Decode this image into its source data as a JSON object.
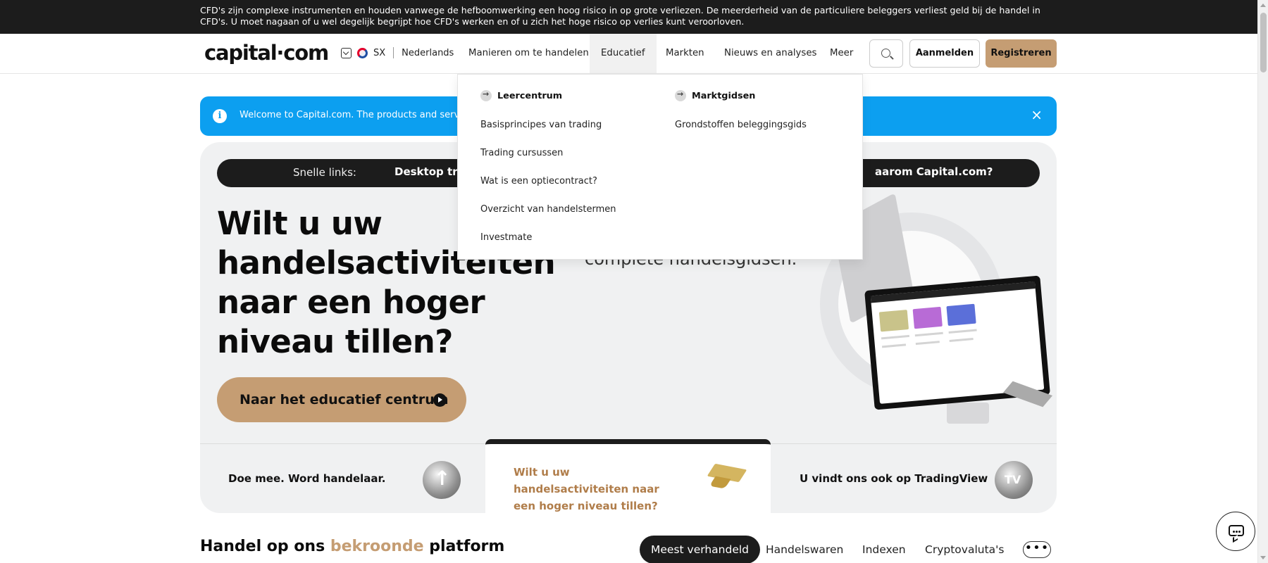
{
  "risk_banner": {
    "text": "CFD's zijn complexe instrumenten en houden vanwege de hefboomwerking een hoog risico in op grote verliezen. De meerderheid van de particuliere beleggers verliest geld bij de handel in CFD's. U moet nagaan of u wel degelijk begrijpt hoe CFD's werken en of u zich het hoge risico op verlies kunt veroorloven."
  },
  "header": {
    "logo": "capital·com",
    "region": "SX",
    "language": "Nederlands",
    "nav": [
      "Manieren om te handelen",
      "Educatief",
      "Markten",
      "Nieuws en analyses",
      "Meer"
    ],
    "login_label": "Aanmelden",
    "register_label": "Registreren",
    "accent_color": "#c59d73"
  },
  "welcome": {
    "text": "Welcome to Capital.com. The products and services",
    "close": "×",
    "color": "#0c9ff0"
  },
  "dropdown": {
    "col1_title": "Leercentrum",
    "col1_links": [
      "Basisprincipes van trading",
      "Trading cursussen",
      "Wat is een optiecontract?",
      "Overzicht van handelstermen",
      "Investmate"
    ],
    "col2_title": "Marktgidsen",
    "col2_links": [
      "Grondstoffen beleggingsgids"
    ]
  },
  "hero": {
    "quick_label": "Snelle links:",
    "quick_link_1": "Desktop tradin",
    "quick_link_2": "aarom Capital.com?",
    "title": "Wilt u uw handelsactiviteiten naar een hoger niveau tillen?",
    "subtitle": "complete handelsgidsen.",
    "cta_label": "Naar het educatief centrum"
  },
  "hero_bottom": {
    "item1": "Doe mee. Word handelaar.",
    "item2": "Wilt u uw handelsactiviteiten naar een hoger niveau tillen?",
    "item3": "U vindt ons ook op TradingView"
  },
  "platform_section": {
    "title_pre": "Handel op ons ",
    "title_hl": "bekroonde",
    "title_post": " platform",
    "tabs": [
      "Meest verhandeld",
      "Handelswaren",
      "Indexen",
      "Cryptovaluta's"
    ],
    "more": "•••"
  }
}
